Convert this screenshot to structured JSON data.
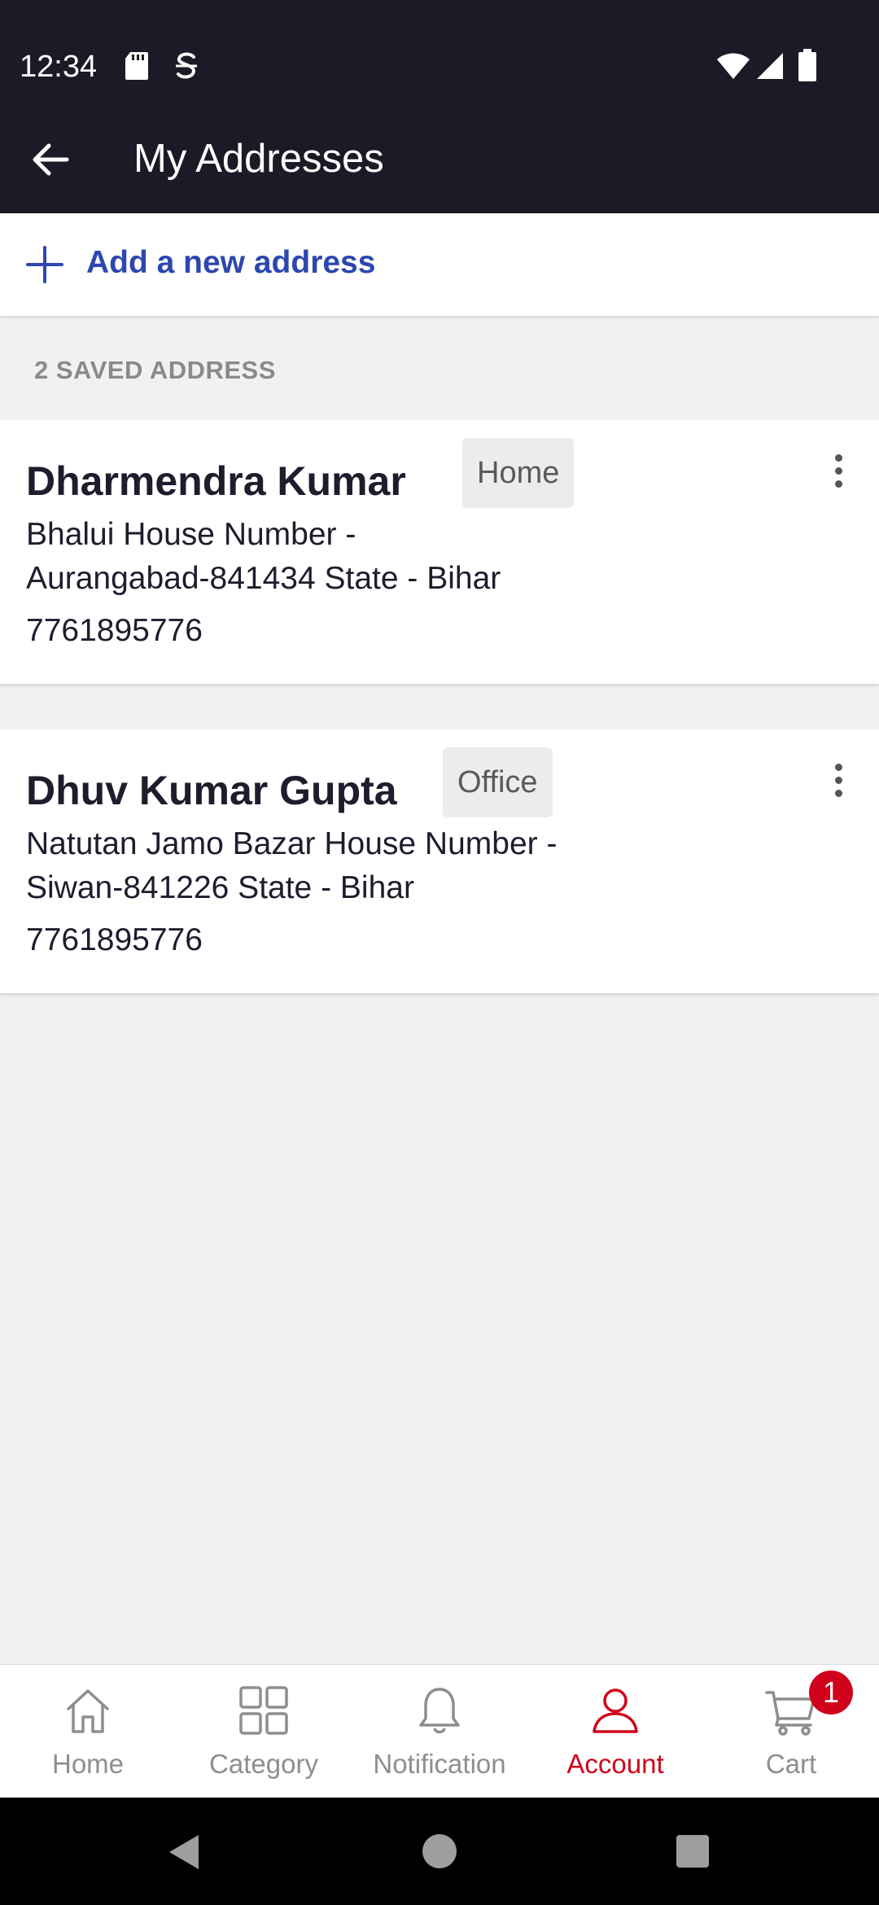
{
  "status_bar": {
    "time": "12:34",
    "icons": [
      "sd-card-icon",
      "s-notification-icon",
      "wifi-icon",
      "signal-icon",
      "battery-icon"
    ]
  },
  "app_bar": {
    "title": "My Addresses",
    "back_icon": "arrow-left-icon"
  },
  "add_address": {
    "label": "Add a new address",
    "icon": "plus-icon"
  },
  "saved_section": {
    "label": "2 SAVED ADDRESS"
  },
  "addresses": [
    {
      "name": "Dharmendra Kumar",
      "tag": "Home",
      "line1": "Bhalui House Number -",
      "line2": "Aurangabad-841434 State - Bihar",
      "phone": "7761895776"
    },
    {
      "name": "Dhuv Kumar Gupta",
      "tag": "Office",
      "line1": "Natutan Jamo Bazar House Number -",
      "line2": "Siwan-841226 State - Bihar",
      "phone": "7761895776"
    }
  ],
  "bottom_nav": {
    "items": [
      {
        "label": "Home",
        "icon": "home-icon"
      },
      {
        "label": "Category",
        "icon": "grid-icon"
      },
      {
        "label": "Notification",
        "icon": "bell-icon"
      },
      {
        "label": "Account",
        "icon": "user-icon",
        "active": true
      },
      {
        "label": "Cart",
        "icon": "cart-icon"
      }
    ],
    "cart_badge": "1"
  },
  "colors": {
    "header_bg": "#1a1b26",
    "accent_blue": "#2c47b0",
    "active_red": "#d0021b",
    "page_bg": "#f1f1f1"
  }
}
